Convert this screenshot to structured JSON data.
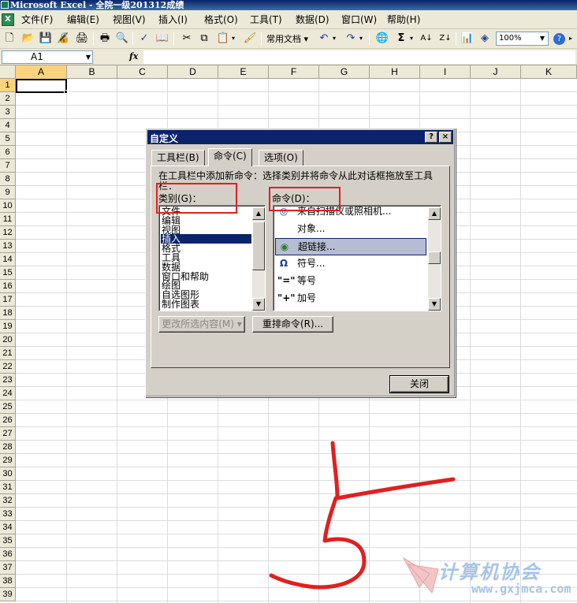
{
  "window": {
    "title": "Microsoft Excel - 全院一级201312成绩"
  },
  "menubar": {
    "items": [
      "文件(F)",
      "编辑(E)",
      "视图(V)",
      "插入(I)",
      "格式(O)",
      "工具(T)",
      "数据(D)",
      "窗口(W)",
      "帮助(H)"
    ]
  },
  "toolbar": {
    "font_style_label": "常用文档",
    "sum_glyph": "Σ",
    "zoom": "100%",
    "icons": [
      "new-icon",
      "open-icon",
      "save-icon",
      "permission-icon",
      "print-icon",
      "print-preview-icon",
      "spelling-icon",
      "research-icon",
      "cut-icon",
      "copy-icon",
      "paste-icon",
      "format-painter-icon",
      "undo-icon",
      "redo-icon",
      "hyperlink-icon",
      "autosum-icon",
      "sort-ascending-icon",
      "sort-descending-icon",
      "chart-wizard-icon",
      "drawing-icon",
      "help-icon"
    ]
  },
  "formulabar": {
    "name_box": "A1",
    "fx": "fx",
    "formula": ""
  },
  "grid": {
    "columns": [
      "A",
      "B",
      "C",
      "D",
      "E",
      "F",
      "G",
      "H",
      "I",
      "J",
      "K"
    ],
    "rows": [
      "1",
      "2",
      "3",
      "4",
      "5",
      "6",
      "7",
      "8",
      "9",
      "10",
      "11",
      "12",
      "13",
      "14",
      "15",
      "16",
      "17",
      "18",
      "19",
      "20",
      "21",
      "22",
      "23",
      "24",
      "25",
      "26",
      "27",
      "28",
      "29",
      "30",
      "31",
      "32",
      "33",
      "34",
      "35",
      "36",
      "37",
      "38",
      "39"
    ],
    "active_cell": "A1"
  },
  "dialog": {
    "title": "自定义",
    "help_button": "?",
    "close_button": "×",
    "tabs": [
      "工具栏(B)",
      "命令(C)",
      "选项(O)"
    ],
    "active_tab": "命令(C)",
    "description": "在工具栏中添加新命令：选择类别并将命令从此对话框拖放至工具栏：",
    "categories_label": "类别(G)：",
    "commands_label": "命令(D)：",
    "categories": [
      "文件",
      "编辑",
      "视图",
      "插入",
      "格式",
      "工具",
      "数据",
      "窗口和帮助",
      "绘图",
      "自选图形",
      "制作图表"
    ],
    "selected_category": "插入",
    "commands": [
      {
        "icon": "scanner-camera-icon",
        "glyph": "◎",
        "label": "来自扫描仪或照相机..."
      },
      {
        "icon": "object-icon",
        "glyph": "",
        "label": "对象..."
      },
      {
        "icon": "hyperlink-icon",
        "glyph": "◉",
        "label": "超链接..."
      },
      {
        "icon": "symbol-icon",
        "glyph": "Ω",
        "label": "符号..."
      },
      {
        "icon": "equal-sign-icon",
        "glyph": "\"=\"",
        "label": "等号"
      },
      {
        "icon": "plus-sign-icon",
        "glyph": "\"+\"",
        "label": "加号"
      }
    ],
    "selected_command": "超链接...",
    "modify_selection_button": "更改所选内容(M) ▾",
    "rearrange_button": "重排命令(R)...",
    "close_label": "关闭"
  },
  "annotation": {
    "handwritten": "5"
  },
  "watermark": {
    "text": "计算机协会",
    "url": "www.gxjmca.com"
  },
  "colors": {
    "annotation_red": "#e21f1f",
    "selection_blue": "#0a246a",
    "header_highlight": "#fbd37c"
  }
}
